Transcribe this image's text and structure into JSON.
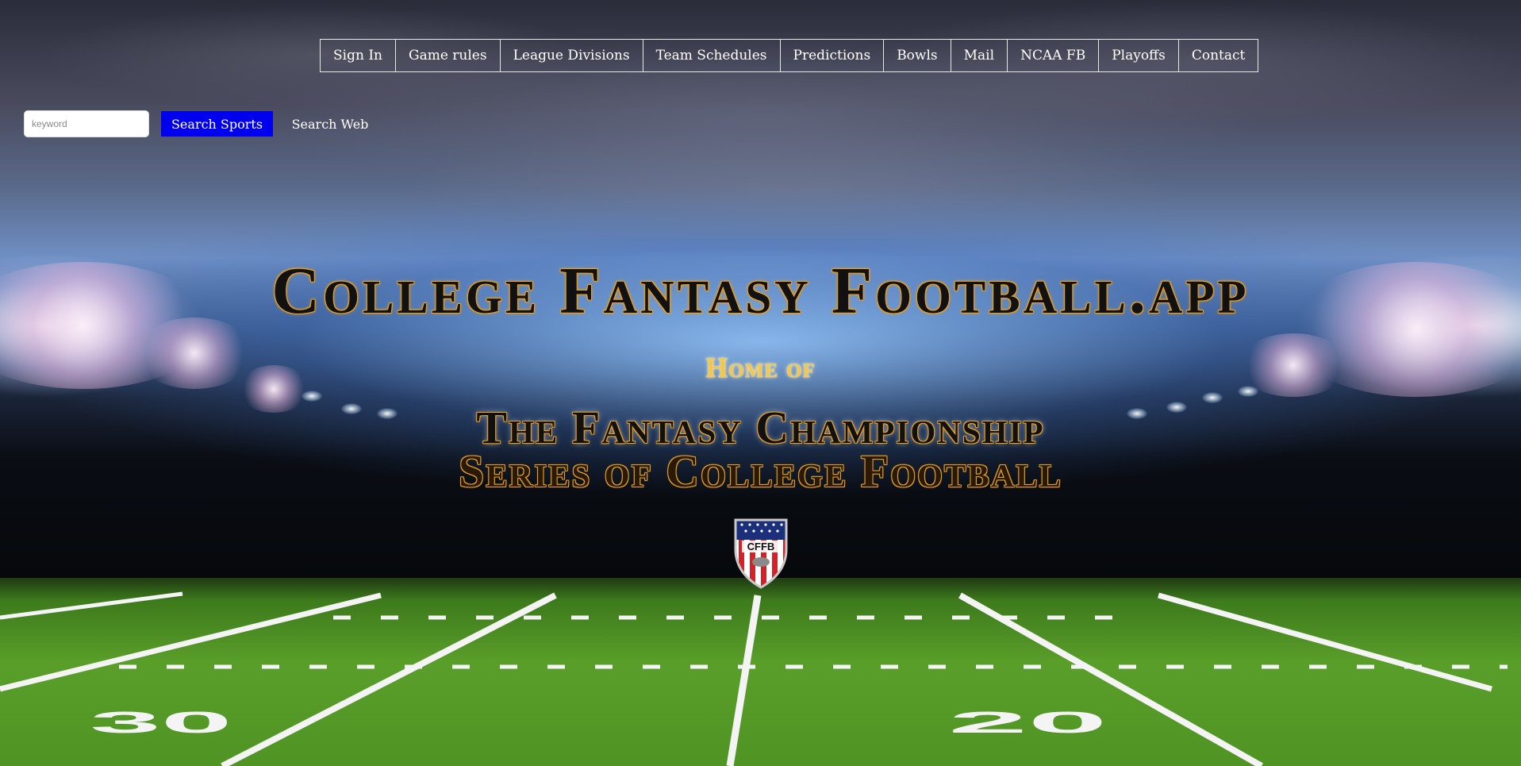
{
  "nav": {
    "items": [
      {
        "label": "Sign In"
      },
      {
        "label": "Game rules"
      },
      {
        "label": "League Divisions"
      },
      {
        "label": "Team Schedules"
      },
      {
        "label": "Predictions"
      },
      {
        "label": "Bowls"
      },
      {
        "label": "Mail"
      },
      {
        "label": "NCAA FB"
      },
      {
        "label": "Playoffs"
      },
      {
        "label": "Contact"
      }
    ]
  },
  "search": {
    "placeholder": "keyword",
    "value": "",
    "sports_button": "Search Sports",
    "web_button": "Search Web"
  },
  "hero": {
    "title": "College Fantasy Football.app",
    "subtitle": "Home of",
    "tagline_line1": "The Fantasy Championship",
    "tagline_line2": "Series of College Football"
  },
  "crest": {
    "text": "CFFB",
    "icon": "shield-crest-icon"
  },
  "field": {
    "yard_left": "30",
    "yard_right": "20"
  },
  "colors": {
    "search_sports_button": "#0000ee",
    "title_outline": "#e8a020",
    "subtitle": "#f3c84a"
  }
}
